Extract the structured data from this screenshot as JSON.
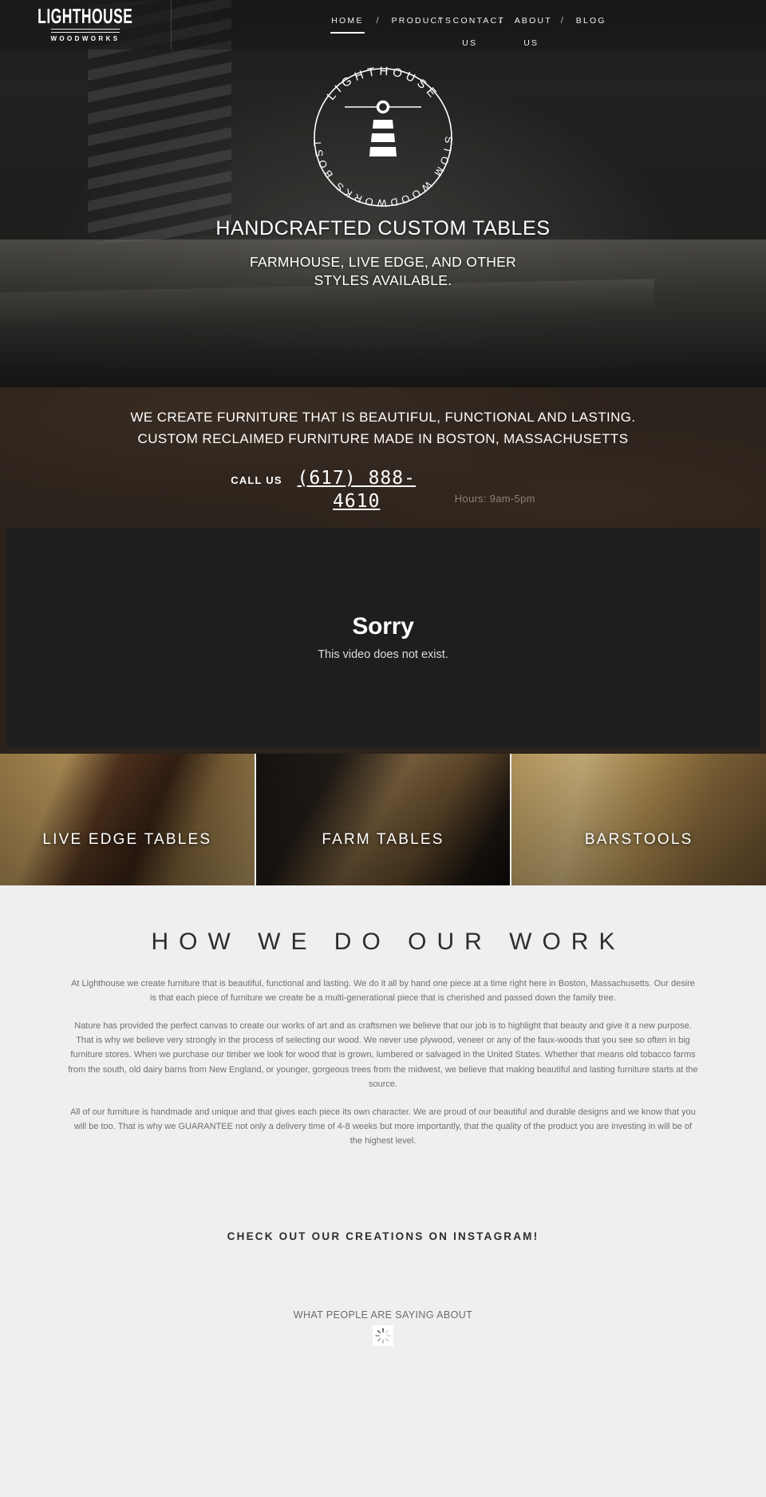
{
  "brand": {
    "logo_main": "LIGHTHOUSE",
    "logo_sub": "WOODWORKS",
    "badge_top": "LIGHTHOUSE",
    "badge_left": "CUSTOM",
    "badge_bottom": "WOODWORKS",
    "badge_right": "BOSTON"
  },
  "nav": {
    "items": [
      {
        "label": "HOME",
        "active": true
      },
      {
        "label": "PRODUCTS",
        "active": false
      },
      {
        "label": "CONTACT US",
        "active": false
      },
      {
        "label": "ABOUT US",
        "active": false
      },
      {
        "label": "BLOG",
        "active": false
      }
    ],
    "separator": "/"
  },
  "hero": {
    "headline": "HANDCRAFTED CUSTOM TABLES",
    "subline_1": "FARMHOUSE, LIVE EDGE, AND OTHER",
    "subline_2": "STYLES AVAILABLE."
  },
  "banner": {
    "line_1": "WE CREATE FURNITURE THAT IS BEAUTIFUL, FUNCTIONAL AND LASTING.",
    "line_2": "CUSTOM RECLAIMED FURNITURE MADE IN BOSTON, MASSACHUSETTS",
    "call_label": "CALL US",
    "phone": "(617) 888-4610",
    "hours": "Hours: 9am-5pm"
  },
  "video": {
    "title": "Sorry",
    "message": "This video does not exist."
  },
  "tiles": [
    {
      "label": "LIVE EDGE TABLES"
    },
    {
      "label": "FARM TABLES"
    },
    {
      "label": "BARSTOOLS"
    }
  ],
  "work": {
    "heading": "HOW WE DO OUR WORK",
    "paragraphs": [
      "At Lighthouse we create furniture that is beautiful, functional and lasting. We do it all by hand one piece at a time right here in Boston, Massachusetts. Our desire is that each piece of furniture we create be a multi-generational piece that is cherished and passed down the family tree.",
      "Nature has provided the perfect canvas to create our works of art and as craftsmen we believe that our job is to highlight that beauty and give it a new purpose. That is why we believe very strongly in the process of selecting our wood. We never use plywood, veneer or any of the faux-woods that you see so often in big furniture stores. When we purchase our timber we look for wood that is grown, lumbered or salvaged in the United States. Whether that means old tobacco farms from the south, old dairy barns from New England, or younger, gorgeous trees from the midwest, we believe that making beautiful and lasting furniture starts at the source.",
      "All of our furniture is handmade and unique and that gives each piece its own character. We are proud of our beautiful and durable designs and we know that you will be too. That is why we GUARANTEE not only a delivery time of 4-8 weeks but more importantly, that the quality of the product you are investing in will be of the highest level."
    ]
  },
  "instagram": {
    "heading": "CHECK OUT OUR CREATIONS ON INSTAGRAM!"
  },
  "testimonials": {
    "heading": "WHAT PEOPLE ARE SAYING ABOUT"
  },
  "colors": {
    "banner_bg": "#2b221b",
    "video_bg": "#1e1e1e",
    "page_bg": "#efefef",
    "text_light": "#ffffff",
    "text_muted": "#6f6f6f",
    "hours_color": "#8d8179"
  }
}
